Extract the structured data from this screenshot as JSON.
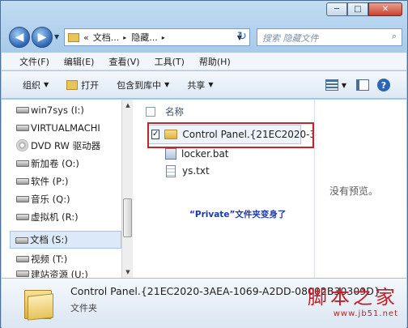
{
  "window": {
    "controls": {
      "minimize": "─",
      "maximize": "□",
      "close": "✕"
    }
  },
  "nav": {
    "back_glyph": "◀",
    "forward_glyph": "▶",
    "dropdown_glyph": "▼",
    "refresh_glyph": "↻"
  },
  "address": {
    "prefix": "«",
    "crumbs": [
      "文档...",
      "隐藏..."
    ],
    "separator": "▸"
  },
  "search": {
    "placeholder": "搜索 隐藏文件",
    "icon": "magnifier-icon",
    "glyph": "⌕"
  },
  "menu": [
    "文件(F)",
    "编辑(E)",
    "查看(V)",
    "工具(T)",
    "帮助(H)"
  ],
  "toolbar": {
    "organize": "组织",
    "open": "打开",
    "include_in_library": "包含到库中",
    "share": "共享",
    "arrow": "▼",
    "help": "?"
  },
  "sidebar": {
    "items": [
      {
        "label": "win7sys (I:)",
        "icon": "drive-icon"
      },
      {
        "label": "VIRTUALMACHI",
        "icon": "drive-icon"
      },
      {
        "label": "DVD RW 驱动器",
        "icon": "dvd-icon"
      },
      {
        "label": "新加卷 (O:)",
        "icon": "drive-icon"
      },
      {
        "label": "软件 (P:)",
        "icon": "drive-icon"
      },
      {
        "label": "音乐 (Q:)",
        "icon": "drive-icon"
      },
      {
        "label": "虚拟机 (R:)",
        "icon": "drive-icon"
      },
      {
        "label": "文档 (S:)",
        "icon": "drive-icon",
        "selected": true
      },
      {
        "label": "视频 (T:)",
        "icon": "drive-icon"
      },
      {
        "label": "建站资源 (U:)",
        "icon": "drive-icon"
      }
    ],
    "scroll_up": "▲",
    "scroll_down": "▼"
  },
  "files": {
    "column_name": "名称",
    "rows": [
      {
        "name": "Control Panel.{21EC2020-3",
        "type": "folder",
        "checked": true,
        "check_glyph": "✓"
      },
      {
        "name": "locker.bat",
        "type": "bat"
      },
      {
        "name": "ys.txt",
        "type": "txt"
      }
    ]
  },
  "caption": "“Private”文件夹变身了",
  "preview": {
    "empty_text": "没有预览。"
  },
  "details": {
    "name": "Control Panel.{21EC2020-3AEA-1069-A2DD-08002B30309D}",
    "type": "文件夹"
  },
  "watermark": {
    "title": "脚本之家",
    "url": "www.jb51.net"
  },
  "colors": {
    "highlight_border": "#c0262c",
    "caption": "#1b3aa8",
    "watermark": "#c31d27"
  }
}
